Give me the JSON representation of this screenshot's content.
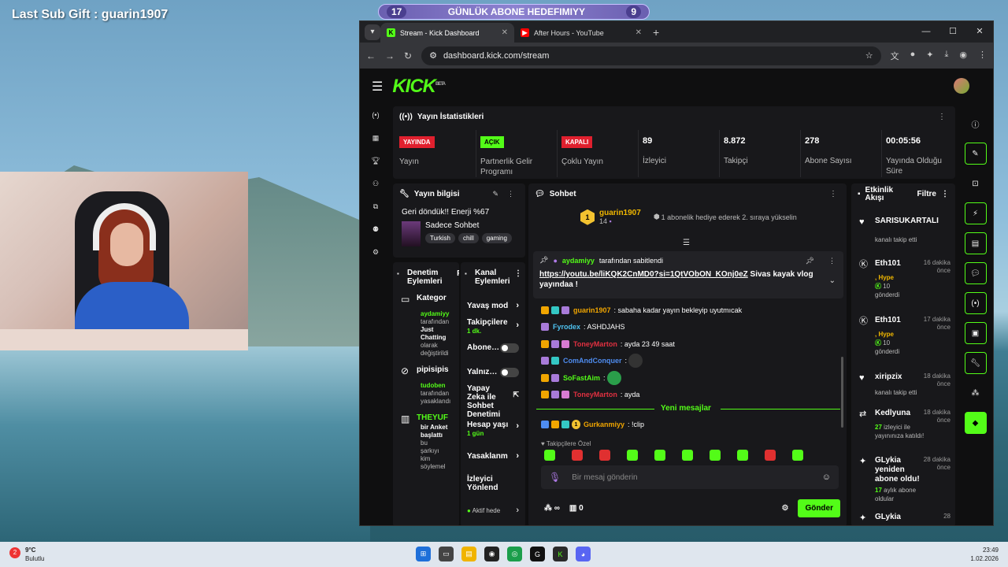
{
  "overlay": {
    "last_sub_gift": "Last Sub Gift : guarin1907"
  },
  "goal": {
    "left": "17",
    "title": "GÜNLÜK ABONE HEDEFIMIYY",
    "right": "9"
  },
  "browser": {
    "tabs": [
      {
        "title": "Stream - Kick Dashboard",
        "active": true
      },
      {
        "title": "After Hours - YouTube",
        "active": false
      }
    ],
    "url": "dashboard.kick.com/stream"
  },
  "kick": {
    "logo": "KICK",
    "beta": "BETA"
  },
  "stats": {
    "title": "Yayın İstatistikleri",
    "items": [
      {
        "badge": "YAYINDA",
        "label": "Yayın"
      },
      {
        "badge": "AÇIK",
        "label": "Partnerlik Gelir Programı"
      },
      {
        "badge": "KAPALI",
        "label": "Çoklu Yayın"
      },
      {
        "value": "89",
        "label": "İzleyici"
      },
      {
        "value": "8.872",
        "label": "Takipçi"
      },
      {
        "value": "278",
        "label": "Abone Sayısı"
      },
      {
        "value": "00:05:56",
        "label": "Yayında Olduğu Süre"
      }
    ]
  },
  "info": {
    "title": "Yayın bilgisi",
    "stream_title": "Geri döndük!! Enerji %67",
    "category": "Sadece Sohbet",
    "tags": [
      "Turkish",
      "chill",
      "gaming"
    ]
  },
  "denetim": {
    "title": "Denetim Eylemleri",
    "filter": "Fi",
    "items": [
      {
        "head": "Kategor",
        "who": "aydamiyy",
        "text": [
          "tarafından",
          "Just",
          "Chatting",
          "olarak",
          "değiştirildi"
        ]
      },
      {
        "head": "pipisipis",
        "who": "tudoben",
        "text": [
          "tarafından",
          "yasaklandı"
        ]
      },
      {
        "head": "THEYUF",
        "who": "",
        "text": [
          "bir Anket başlattı",
          "bu",
          "şarkıyı",
          "kim",
          "söylemel"
        ]
      }
    ]
  },
  "kanal": {
    "title": "Kanal Eylemleri",
    "items": [
      {
        "label": "Yavaş mod"
      },
      {
        "label": "Takipçilere",
        "sub": "1 dk."
      },
      {
        "label": "Abone…"
      },
      {
        "label": "Yalnız…"
      },
      {
        "label": "Yapay Zeka ile Sohbet Denetimi"
      },
      {
        "label": "Hesap yaşı",
        "sub": "1 gün"
      },
      {
        "label": "Yasaklanm"
      },
      {
        "label": "İzleyici Yönlend"
      },
      {
        "label": "Aktif hede"
      }
    ]
  },
  "chat": {
    "title": "Sohbet",
    "gifter": {
      "name": "guarin1907",
      "count": "14",
      "badge": "1",
      "message": "1 abonelik hediye ederek 2. sıraya yükselin"
    },
    "pinned": {
      "by": "aydamiyy",
      "by_suffix": "tarafından sabitlendi",
      "link": "https://youtu.be/liKQK2CnMD0?si=1QtVObON_KOnj0eZ",
      "text": " Sivas kayak vlog yayındaa !"
    },
    "messages": [
      {
        "user": "guarin1907",
        "color": "#f0a500",
        "text": ": sabaha kadar yayın bekleyip uyutmıcak"
      },
      {
        "user": "Fyrodex",
        "color": "#4ec2f0",
        "text": ": ASHDJAHS"
      },
      {
        "user": "ToneyMarton",
        "color": "#e03040",
        "text": ": ayda 23 49 saat"
      },
      {
        "user": "ComAndConquer",
        "color": "#4e8cf0",
        "text": ":"
      },
      {
        "user": "SoFastAim",
        "color": "#53fc18",
        "text": ":"
      },
      {
        "user": "ToneyMarton",
        "color": "#e03040",
        "text": ": ayda"
      }
    ],
    "new_messages": "Yeni mesajlar",
    "last": {
      "badge": "1",
      "user": "Gurkanmiyy",
      "color": "#f0a500",
      "text": ": !clip"
    },
    "followers_only": "Takipçilere Özel",
    "placeholder": "Bir mesaj gönderin",
    "infinity": "∞",
    "count": "0",
    "send": "Gönder"
  },
  "activity": {
    "title": "Etkinlik Akışı",
    "filter": "Filtre",
    "items": [
      {
        "name": "SARISUKARTALI",
        "time": "",
        "detail": "kanalı takip etti"
      },
      {
        "name": "Eth101",
        "time": "16 dakika önce",
        "hype": ", Hype",
        "num": "10",
        "detail": "gönderdi"
      },
      {
        "name": "Eth101",
        "time": "17 dakika önce",
        "hype": ", Hype",
        "num": "10",
        "detail": "gönderdi"
      },
      {
        "name": "xiripzix",
        "time": "18 dakika önce",
        "detail": "kanalı takip etti"
      },
      {
        "name": "Kedlyuna",
        "time": "18 dakika önce",
        "num": "27",
        "detail": "izleyici ile yayınınıza katıldı!"
      },
      {
        "name": "GLykia yeniden abone oldu!",
        "time": "28 dakika önce",
        "num": "17",
        "detail": "aylık abone oldular"
      },
      {
        "name": "GLykia",
        "time": "28"
      }
    ]
  },
  "taskbar": {
    "temp": "9°C",
    "weather": "Bulutlu",
    "alert": "2",
    "time": "23:49",
    "date": "1.02.2026"
  }
}
